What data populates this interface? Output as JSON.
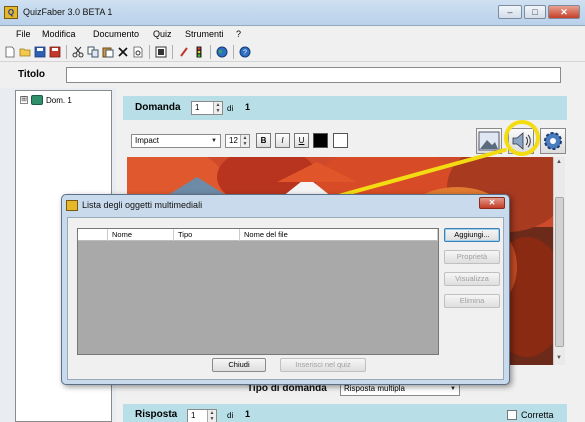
{
  "app": {
    "icon_text": "Q",
    "title": "QuizFaber 3.0 BETA 1",
    "minimize": "–",
    "maximize": "□",
    "close": "✕"
  },
  "menu": [
    "File",
    "Modifica",
    "Documento",
    "Quiz",
    "Strumenti",
    "?"
  ],
  "toolbar_icons": [
    "new-icon",
    "open-icon",
    "save-icon",
    "save-all-icon",
    "cut-icon",
    "copy-icon",
    "paste-icon",
    "delete-icon",
    "preview-icon",
    "export-icon",
    "pencil-icon",
    "traffic-light-icon",
    "globe-icon",
    "help-icon"
  ],
  "titolo": {
    "label": "Titolo",
    "value": ""
  },
  "tree": {
    "expander": "⊞",
    "root_label": "Dom. 1"
  },
  "domanda": {
    "label": "Domanda",
    "number": "1",
    "of_label": "di",
    "total": "1"
  },
  "format": {
    "font_name": "Impact",
    "font_size": "12",
    "bold": "B",
    "italic": "I",
    "underline": "U",
    "colors": {
      "fore": "#000000",
      "back": "#ffffff"
    }
  },
  "media_buttons": [
    "image-icon",
    "audio-icon",
    "gear-icon"
  ],
  "tipo": {
    "label": "Tipo di domanda",
    "value": "Risposta multipla"
  },
  "risposta": {
    "label": "Risposta",
    "number": "1",
    "of_label": "di",
    "total": "1",
    "correct_label": "Corretta",
    "correct_checked": false
  },
  "dialog": {
    "title": "Lista degli oggetti multimediali",
    "close": "✕",
    "columns": [
      "",
      "Nome",
      "Tipo",
      "Nome del file"
    ],
    "rows": [],
    "buttons": {
      "add": "Aggiungi...",
      "properties": "Proprietà",
      "view": "Visualizza",
      "delete": "Elimina",
      "close": "Chiudi",
      "insert": "Inserisci nel quiz"
    }
  },
  "colors": {
    "band": "#b8dfe8",
    "highlight": "#f3dc12",
    "list_bg": "#a9a9a9"
  }
}
